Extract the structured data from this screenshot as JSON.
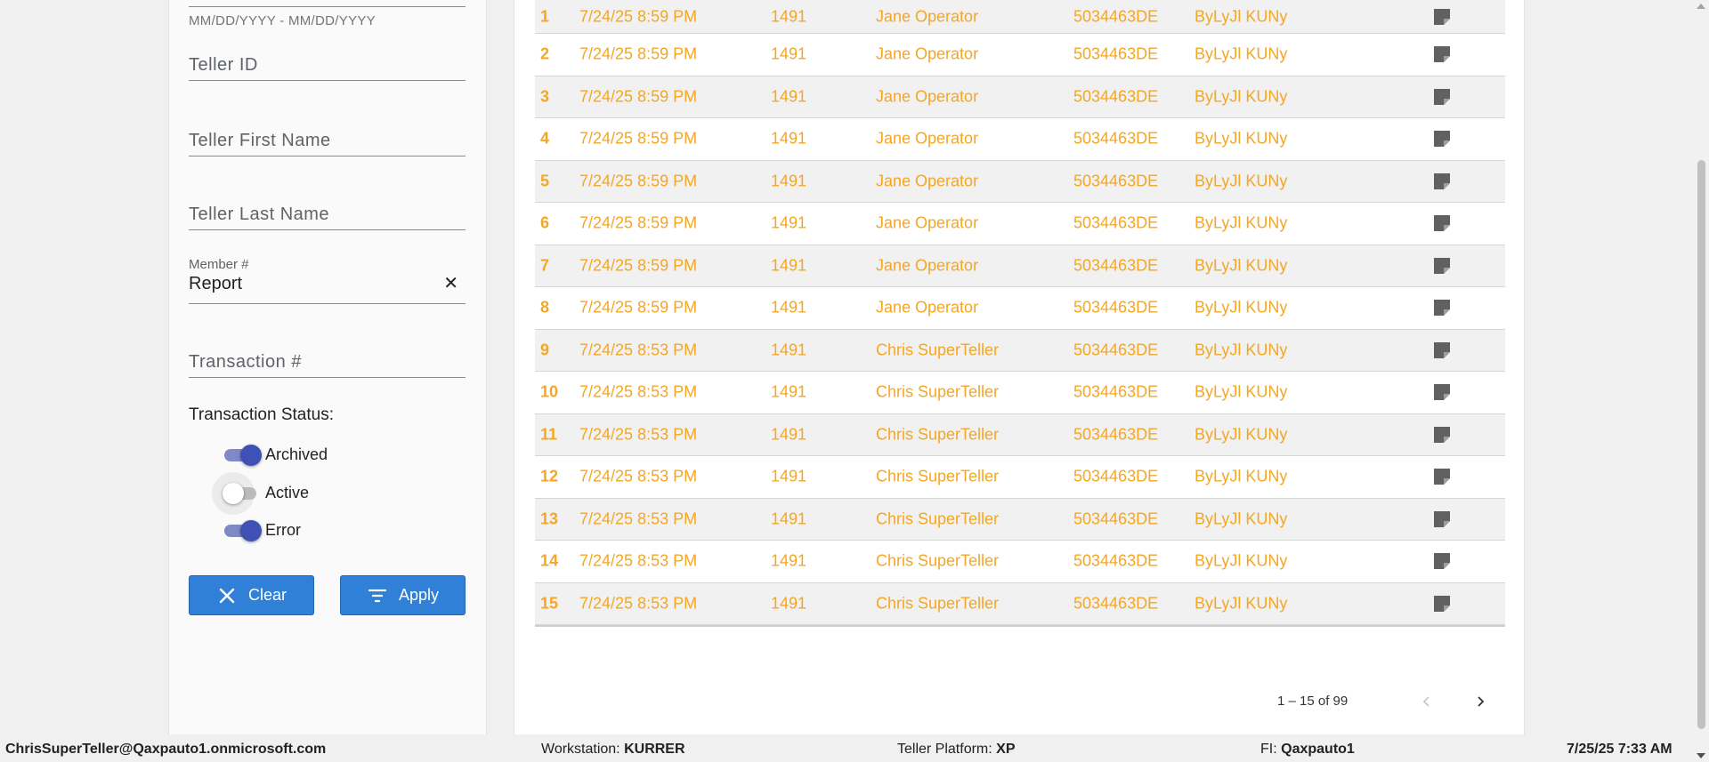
{
  "filters": {
    "date_range_hint": "MM/DD/YYYY - MM/DD/YYYY",
    "teller_id_placeholder": "Teller ID",
    "teller_first_name_placeholder": "Teller First Name",
    "teller_last_name_placeholder": "Teller Last Name",
    "member_label": "Member #",
    "member_value": "Report",
    "transaction_placeholder": "Transaction #",
    "status_title": "Transaction Status:",
    "statuses": [
      {
        "label": "Archived",
        "on": true
      },
      {
        "label": "Active",
        "on": false
      },
      {
        "label": "Error",
        "on": true
      }
    ],
    "clear_label": "Clear",
    "apply_label": "Apply",
    "clear_symbol": "✕"
  },
  "table": {
    "rows": [
      {
        "num": "1",
        "date": "7/24/25 8:59 PM",
        "code": "1491",
        "teller": "Jane Operator",
        "workstation": "5034463DE",
        "id": "ByLyJl KUNy"
      },
      {
        "num": "2",
        "date": "7/24/25 8:59 PM",
        "code": "1491",
        "teller": "Jane Operator",
        "workstation": "5034463DE",
        "id": "ByLyJl KUNy"
      },
      {
        "num": "3",
        "date": "7/24/25 8:59 PM",
        "code": "1491",
        "teller": "Jane Operator",
        "workstation": "5034463DE",
        "id": "ByLyJl KUNy"
      },
      {
        "num": "4",
        "date": "7/24/25 8:59 PM",
        "code": "1491",
        "teller": "Jane Operator",
        "workstation": "5034463DE",
        "id": "ByLyJl KUNy"
      },
      {
        "num": "5",
        "date": "7/24/25 8:59 PM",
        "code": "1491",
        "teller": "Jane Operator",
        "workstation": "5034463DE",
        "id": "ByLyJl KUNy"
      },
      {
        "num": "6",
        "date": "7/24/25 8:59 PM",
        "code": "1491",
        "teller": "Jane Operator",
        "workstation": "5034463DE",
        "id": "ByLyJl KUNy"
      },
      {
        "num": "7",
        "date": "7/24/25 8:59 PM",
        "code": "1491",
        "teller": "Jane Operator",
        "workstation": "5034463DE",
        "id": "ByLyJl KUNy"
      },
      {
        "num": "8",
        "date": "7/24/25 8:59 PM",
        "code": "1491",
        "teller": "Jane Operator",
        "workstation": "5034463DE",
        "id": "ByLyJl KUNy"
      },
      {
        "num": "9",
        "date": "7/24/25 8:53 PM",
        "code": "1491",
        "teller": "Chris SuperTeller",
        "workstation": "5034463DE",
        "id": "ByLyJl KUNy"
      },
      {
        "num": "10",
        "date": "7/24/25 8:53 PM",
        "code": "1491",
        "teller": "Chris SuperTeller",
        "workstation": "5034463DE",
        "id": "ByLyJl KUNy"
      },
      {
        "num": "11",
        "date": "7/24/25 8:53 PM",
        "code": "1491",
        "teller": "Chris SuperTeller",
        "workstation": "5034463DE",
        "id": "ByLyJl KUNy"
      },
      {
        "num": "12",
        "date": "7/24/25 8:53 PM",
        "code": "1491",
        "teller": "Chris SuperTeller",
        "workstation": "5034463DE",
        "id": "ByLyJl KUNy"
      },
      {
        "num": "13",
        "date": "7/24/25 8:53 PM",
        "code": "1491",
        "teller": "Chris SuperTeller",
        "workstation": "5034463DE",
        "id": "ByLyJl KUNy"
      },
      {
        "num": "14",
        "date": "7/24/25 8:53 PM",
        "code": "1491",
        "teller": "Chris SuperTeller",
        "workstation": "5034463DE",
        "id": "ByLyJl KUNy"
      },
      {
        "num": "15",
        "date": "7/24/25 8:53 PM",
        "code": "1491",
        "teller": "Chris SuperTeller",
        "workstation": "5034463DE",
        "id": "ByLyJl KUNy"
      }
    ],
    "row_text_color": "#f5a623",
    "note_icon": "note-icon"
  },
  "pagination": {
    "range_text": "1 – 15 of 99",
    "prev_icon": "chevron-left-icon",
    "next_icon": "chevron-right-icon"
  },
  "footer": {
    "user": "ChrisSuperTeller@Qaxpauto1.onmicrosoft.com",
    "workstation_label": "Workstation:",
    "workstation_value": "KURRER",
    "platform_label": "Teller Platform:",
    "platform_value": "XP",
    "fi_label": "FI:",
    "fi_value": "Qaxpauto1",
    "datetime": "7/25/25 7:33 AM"
  },
  "colors": {
    "accent_button": "#2f80d6",
    "toggle_on": "#3f51b5",
    "row_text": "#f5a623"
  }
}
